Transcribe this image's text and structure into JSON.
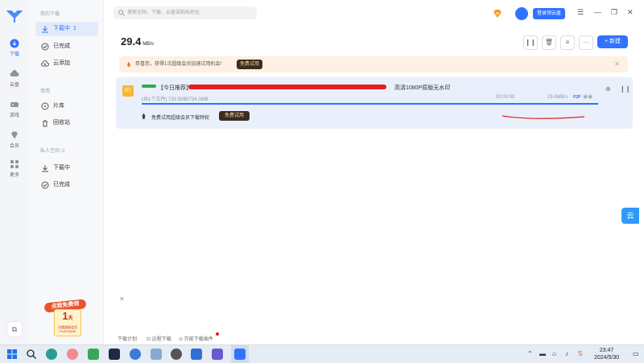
{
  "app": {
    "rail": {
      "items": [
        {
          "label": "下载",
          "icon": "download-icon",
          "active": true
        },
        {
          "label": "云盘",
          "icon": "cloud-icon",
          "active": false
        },
        {
          "label": "游戏",
          "icon": "gamepad-icon",
          "active": false
        },
        {
          "label": "会员",
          "icon": "diamond-icon",
          "active": false
        },
        {
          "label": "更多",
          "icon": "grid-icon",
          "active": false
        }
      ]
    },
    "sidebar": {
      "group_my": "我的下载",
      "downloading": "下载中",
      "downloading_count": "1",
      "completed": "已完成",
      "cloud_add": "云添加",
      "group_common": "常用",
      "theater": "片库",
      "recycle": "回收站",
      "group_private": "私人空间",
      "private_downloading": "下载中",
      "private_completed": "已完成"
    },
    "promo": {
      "tag": "点我免费领",
      "big": "1",
      "unit": "天",
      "line1": "迅雷超级会员",
      "line2": "PLATINUM"
    },
    "search": {
      "placeholder": "搜索全网、下载、云盘或粘贴地址"
    },
    "header": {
      "vip_button": "登录领云盘",
      "speed": "29.4",
      "speed_unit": "MB/s",
      "new_button": "+ 新建"
    },
    "notice": {
      "message": "恭喜您，获得1次超级会员加速试用机会!",
      "try_button": "免费试用"
    },
    "task": {
      "folder_badge": "BT",
      "name_prefix": "【今日推荐】",
      "name_suffix": "高清1080P原版无水印",
      "meta": "(共1个文件)  733.5MB/734.3MB",
      "remaining": "00:00:00",
      "rate": "29.4MB/s",
      "p2p": "P2P",
      "progress": 0.999,
      "vip_msg": "免费试用超级会员下载特权",
      "vip_try": "免费试用"
    },
    "bottom_links": [
      "下载计划",
      "远程下载",
      "万能下载插件"
    ]
  },
  "taskbar": {
    "time": "23:47",
    "date": "2024/5/30"
  },
  "colors": {
    "accent": "#2f73ff",
    "redaction": "#e02020"
  }
}
